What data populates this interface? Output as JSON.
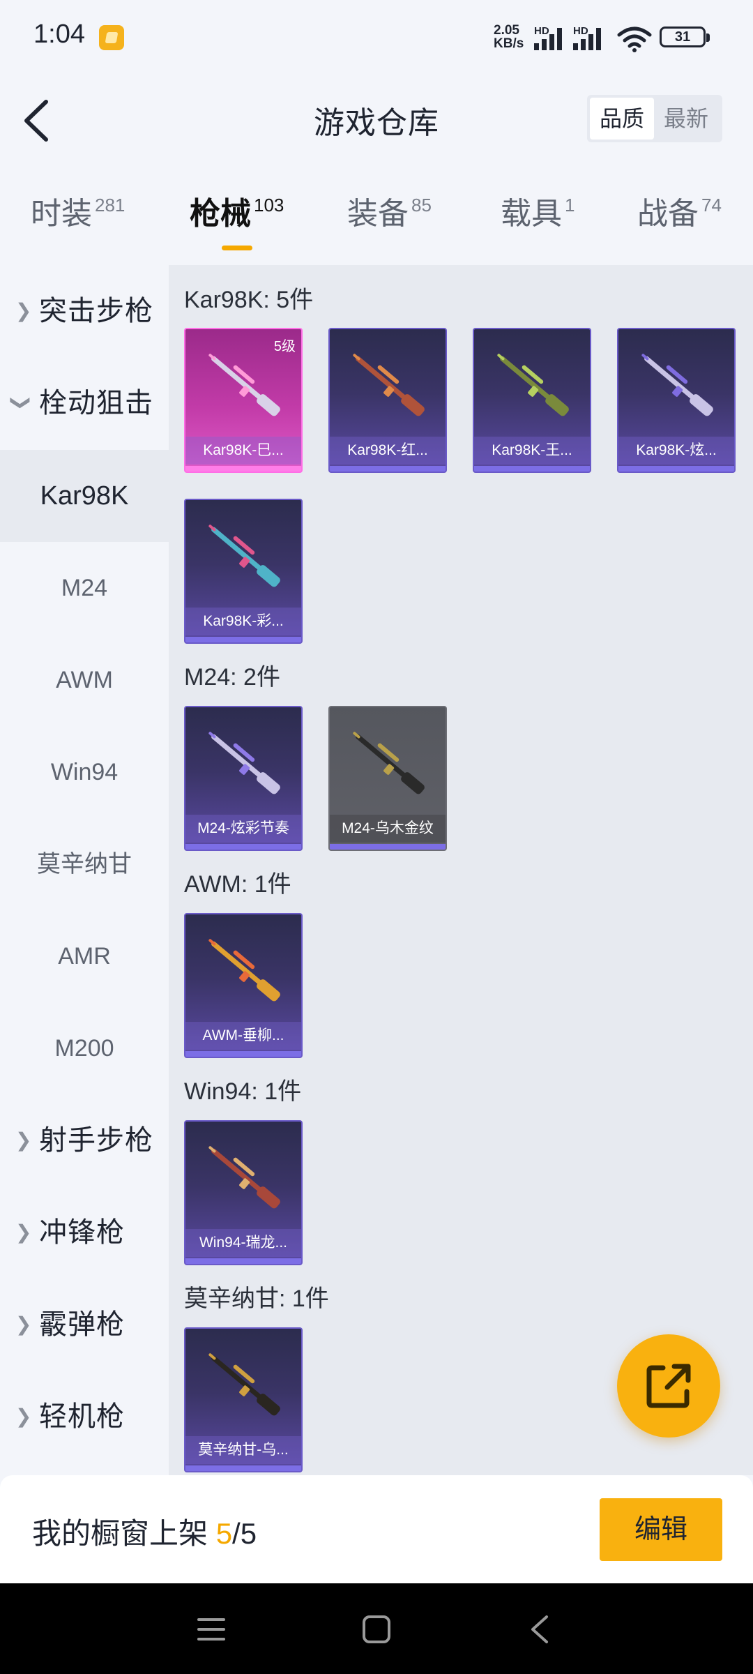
{
  "status_bar": {
    "time": "1:04",
    "net_speed_line1": "2.05",
    "net_speed_line2": "KB/s",
    "hd_label": "HD",
    "battery": "31"
  },
  "header": {
    "title": "游戏仓库",
    "sort_quality": "品质",
    "sort_newest": "最新"
  },
  "tabs": [
    {
      "label": "时装",
      "count": "281"
    },
    {
      "label": "枪械",
      "count": "103"
    },
    {
      "label": "装备",
      "count": "85"
    },
    {
      "label": "载具",
      "count": "1"
    },
    {
      "label": "战备",
      "count": "74"
    }
  ],
  "sidebar": {
    "items": [
      {
        "label": "突击步枪",
        "type": "group",
        "expanded": false
      },
      {
        "label": "栓动狙击",
        "type": "group",
        "expanded": true
      },
      {
        "label": "Kar98K",
        "type": "child",
        "selected": true
      },
      {
        "label": "M24",
        "type": "child"
      },
      {
        "label": "AWM",
        "type": "child"
      },
      {
        "label": "Win94",
        "type": "child"
      },
      {
        "label": "莫辛纳甘",
        "type": "child"
      },
      {
        "label": "AMR",
        "type": "child"
      },
      {
        "label": "M200",
        "type": "child"
      },
      {
        "label": "射手步枪",
        "type": "group",
        "expanded": false
      },
      {
        "label": "冲锋枪",
        "type": "group",
        "expanded": false
      },
      {
        "label": "霰弹枪",
        "type": "group",
        "expanded": false
      },
      {
        "label": "轻机枪",
        "type": "group",
        "expanded": false
      }
    ]
  },
  "sections": [
    {
      "title": "Kar98K: 5件",
      "items": [
        {
          "label": "Kar98K-巳...",
          "level": "5级",
          "rarity": "legendary",
          "gun_color": "#d9d2e8",
          "accent": "#ff9bd8"
        },
        {
          "label": "Kar98K-红...",
          "rarity": "epic",
          "gun_color": "#b0533a",
          "accent": "#e08a4a"
        },
        {
          "label": "Kar98K-王...",
          "rarity": "epic",
          "gun_color": "#7a8a3c",
          "accent": "#b6d060"
        },
        {
          "label": "Kar98K-炫...",
          "rarity": "epic",
          "gun_color": "#c9c3e6",
          "accent": "#7f6ce0"
        },
        {
          "label": "Kar98K-彩...",
          "rarity": "epic",
          "gun_color": "#4fb3c8",
          "accent": "#e0568c"
        }
      ]
    },
    {
      "title": "M24: 2件",
      "items": [
        {
          "label": "M24-炫彩节奏",
          "rarity": "epic",
          "gun_color": "#c9c3e6",
          "accent": "#8f7ae8"
        },
        {
          "label": "M24-乌木金纹",
          "rarity": "common",
          "gun_color": "#2a2a2a",
          "accent": "#b9a14a"
        }
      ]
    },
    {
      "title": "AWM: 1件",
      "items": [
        {
          "label": "AWM-垂柳...",
          "rarity": "epic",
          "gun_color": "#e0a030",
          "accent": "#e86a3a"
        }
      ]
    },
    {
      "title": "Win94: 1件",
      "items": [
        {
          "label": "Win94-瑞龙...",
          "rarity": "epic",
          "gun_color": "#a8483a",
          "accent": "#e0b070"
        }
      ]
    },
    {
      "title": "莫辛纳甘: 1件",
      "items": [
        {
          "label": "莫辛纳甘-乌...",
          "rarity": "epic",
          "gun_color": "#2a2620",
          "accent": "#d0a040"
        }
      ]
    }
  ],
  "bottom": {
    "showcase_label": "我的橱窗上架",
    "showcase_current": "5",
    "showcase_sep": "/",
    "showcase_total": "5",
    "edit_label": "编辑"
  },
  "icons": {
    "back": "back-chevron-icon",
    "share": "share-out-icon",
    "nav_menu": "menu-icon",
    "nav_home": "home-icon",
    "nav_back": "back-icon"
  },
  "colors": {
    "accent": "#f9b10f",
    "legendary": "#e05bc9",
    "epic": "#5b4aa4",
    "common": "#606168"
  }
}
